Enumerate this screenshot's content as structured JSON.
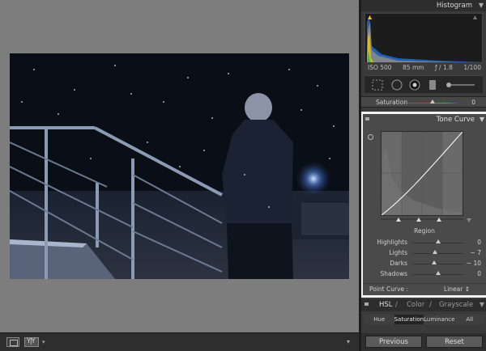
{
  "histogram": {
    "title": "Histogram",
    "iso": "ISO 500",
    "focal": "85 mm",
    "aperture": "ƒ / 1.8",
    "shutter": "1/100"
  },
  "saturation_row": {
    "label": "Saturation",
    "value": "0"
  },
  "tone_curve": {
    "title": "Tone Curve",
    "region_title": "Region",
    "regions": [
      {
        "label": "Highlights",
        "value": "0",
        "level": 0.5
      },
      {
        "label": "Lights",
        "value": "− 7",
        "level": 0.44
      },
      {
        "label": "Darks",
        "value": "− 10",
        "level": 0.42
      },
      {
        "label": "Shadows",
        "value": "0",
        "level": 0.5
      }
    ],
    "point_curve_label": "Point Curve :",
    "point_curve_value": "Linear ↕"
  },
  "hsl": {
    "tabs": [
      "HSL",
      "/",
      "Color",
      "/",
      "Grayscale"
    ],
    "subtabs": [
      {
        "label": "Hue",
        "active": false
      },
      {
        "label": "Saturation",
        "active": true
      },
      {
        "label": "Luminance",
        "active": false
      },
      {
        "label": "All",
        "active": false
      }
    ]
  },
  "buttons": {
    "previous": "Previous",
    "reset": "Reset"
  },
  "toolbar": {
    "compare_glyph": "Y|Y"
  },
  "colors": {
    "accent_white": "#f2f2f2",
    "panel_bg": "#3a3a3a",
    "preview_bg": "#7d7d7d"
  }
}
